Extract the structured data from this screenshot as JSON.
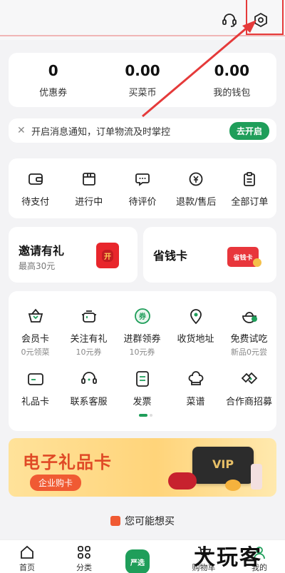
{
  "stats": [
    {
      "value": "0",
      "label": "优惠券"
    },
    {
      "value": "0.00",
      "label": "买菜币"
    },
    {
      "value": "0.00",
      "label": "我的钱包"
    }
  ],
  "notify": {
    "close": "✕",
    "text": "开启消息通知，订单物流及时掌控",
    "button": "去开启"
  },
  "orders": [
    {
      "label": "待支付",
      "icon": "wallet-icon"
    },
    {
      "label": "进行中",
      "icon": "box-icon"
    },
    {
      "label": "待评价",
      "icon": "comment-icon"
    },
    {
      "label": "退款/售后",
      "icon": "refund-icon"
    },
    {
      "label": "全部订单",
      "icon": "clipboard-icon"
    }
  ],
  "promo": {
    "invite_title": "邀请有礼",
    "invite_sub": "最高30元",
    "card_title": "省钱卡",
    "envelope_text": "开",
    "card_badge": "省钱卡"
  },
  "services": [
    {
      "label": "会员卡",
      "sub": "0元领菜",
      "icon": "basket-icon"
    },
    {
      "label": "关注有礼",
      "sub": "10元券",
      "icon": "pot-icon"
    },
    {
      "label": "进群领券",
      "sub": "10元券",
      "icon": "coupon-icon"
    },
    {
      "label": "收货地址",
      "sub": "",
      "icon": "location-icon"
    },
    {
      "label": "免费试吃",
      "sub": "新品0元尝",
      "icon": "bowl-icon"
    },
    {
      "label": "礼品卡",
      "sub": "",
      "icon": "card-icon"
    },
    {
      "label": "联系客服",
      "sub": "",
      "icon": "headset-icon"
    },
    {
      "label": "发票",
      "sub": "",
      "icon": "invoice-icon"
    },
    {
      "label": "菜谱",
      "sub": "",
      "icon": "chef-hat-icon"
    },
    {
      "label": "合作商招募",
      "sub": "",
      "icon": "handshake-icon"
    }
  ],
  "banner": {
    "title": "电子礼品卡",
    "pill": "企业购卡",
    "vip": "VIP"
  },
  "recommend": {
    "text": "您可能想买"
  },
  "tabbar": {
    "home": "首页",
    "category": "分类",
    "center_badge": "严选",
    "cart": "购物车",
    "mine": "我的"
  },
  "watermark": "大玩客",
  "colors": {
    "brand_green": "#1f9e5a",
    "highlight_red": "#e53a3a",
    "banner_orange": "#e04a26"
  }
}
